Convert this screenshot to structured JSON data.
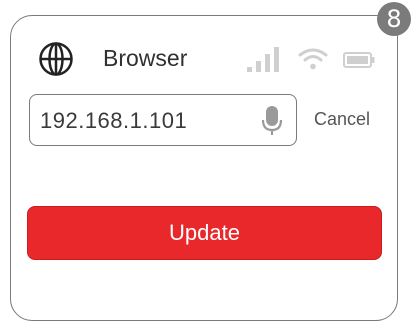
{
  "notification_badge": {
    "count": "8"
  },
  "header": {
    "title": "Browser",
    "icons": {
      "app": "globe-icon",
      "signal": "cellular-signal-icon",
      "wifi": "wifi-icon",
      "battery": "battery-icon"
    }
  },
  "address_bar": {
    "value": "192.168.1.101",
    "mic_icon": "microphone-icon",
    "cancel_label": "Cancel"
  },
  "actions": {
    "update_label": "Update"
  },
  "colors": {
    "accent": "#e8282a",
    "border": "#7a7a7a",
    "badge": "#7b7b7b"
  }
}
